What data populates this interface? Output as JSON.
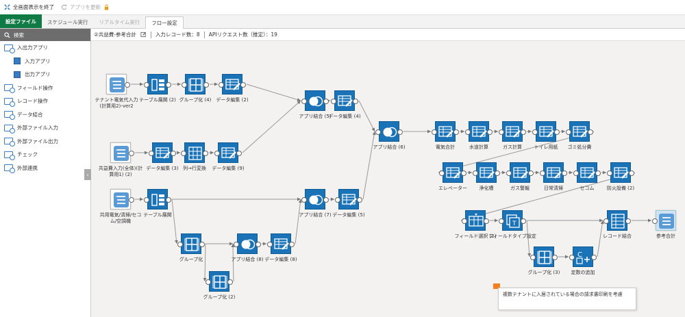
{
  "topbar": {
    "exit_fullscreen": "全画面表示を終了",
    "update_app": "アプリを更新"
  },
  "tabs": [
    {
      "label": "設定ファイル",
      "style": "green"
    },
    {
      "label": "スケジュール実行",
      "style": "normal"
    },
    {
      "label": "リアルタイム実行",
      "style": "dis"
    },
    {
      "label": "フロー設定",
      "style": "active"
    }
  ],
  "sidebar": {
    "search": "検索",
    "items": [
      {
        "label": "入出力アプリ",
        "type": "folder"
      },
      {
        "label": "入力アプリ",
        "type": "app"
      },
      {
        "label": "出力アプリ",
        "type": "app"
      },
      {
        "label": "フィールド操作",
        "type": "folder"
      },
      {
        "label": "レコード操作",
        "type": "folder"
      },
      {
        "label": "データ結合",
        "type": "folder"
      },
      {
        "label": "外部ファイル入力",
        "type": "folder"
      },
      {
        "label": "外部ファイル出力",
        "type": "folder"
      },
      {
        "label": "チェック",
        "type": "folder"
      },
      {
        "label": "外部連携",
        "type": "folder"
      }
    ],
    "collapse": "‹"
  },
  "info": {
    "flow_name": "②共益費-参考合計",
    "input_records": "入力レコード数：8",
    "api_requests": "APIリクエスト数（推定）：19"
  },
  "nodes": [
    {
      "id": "n1",
      "label": "テナント電気代入力(計算用2)-ver2",
      "icon": "input"
    },
    {
      "id": "n2",
      "label": "テーブル展開 (2)",
      "icon": "table-expand"
    },
    {
      "id": "n3",
      "label": "グループ化 (4)",
      "icon": "group"
    },
    {
      "id": "n4",
      "label": "データ編集 (2)",
      "icon": "edit"
    },
    {
      "id": "n5",
      "label": "アプリ結合 (5)",
      "icon": "join"
    },
    {
      "id": "n6",
      "label": "データ編集 (4)",
      "icon": "edit"
    },
    {
      "id": "n7",
      "label": "共益費入力(全体)(計算用1) (2)",
      "icon": "input"
    },
    {
      "id": "n8",
      "label": "データ編集 (3)",
      "icon": "edit"
    },
    {
      "id": "n9",
      "label": "列→行変換",
      "icon": "pivot"
    },
    {
      "id": "n10",
      "label": "データ編集 (9)",
      "icon": "edit"
    },
    {
      "id": "n11",
      "label": "アプリ結合 (6)",
      "icon": "join"
    },
    {
      "id": "n12",
      "label": "共用電気/清掃/セコム/空調機",
      "icon": "input"
    },
    {
      "id": "n13",
      "label": "テーブル展開",
      "icon": "table-expand"
    },
    {
      "id": "n14",
      "label": "アプリ結合 (7)",
      "icon": "join"
    },
    {
      "id": "n15",
      "label": "データ編集 (5)",
      "icon": "edit"
    },
    {
      "id": "n16",
      "label": "グループ化",
      "icon": "group"
    },
    {
      "id": "n17",
      "label": "アプリ結合 (8)",
      "icon": "join"
    },
    {
      "id": "n18",
      "label": "データ編集 (8)",
      "icon": "edit"
    },
    {
      "id": "n19",
      "label": "グループ化 (2)",
      "icon": "group"
    },
    {
      "id": "n20",
      "label": "電気合計",
      "icon": "edit"
    },
    {
      "id": "n21",
      "label": "水道計算",
      "icon": "edit"
    },
    {
      "id": "n22",
      "label": "ガス計算",
      "icon": "edit"
    },
    {
      "id": "n23",
      "label": "トイレ用紙",
      "icon": "edit"
    },
    {
      "id": "n24",
      "label": "ゴミ処分費",
      "icon": "edit"
    },
    {
      "id": "n25",
      "label": "エレベーター",
      "icon": "edit"
    },
    {
      "id": "n26",
      "label": "浄化槽",
      "icon": "edit"
    },
    {
      "id": "n27",
      "label": "ガス警報",
      "icon": "edit"
    },
    {
      "id": "n28",
      "label": "日常清掃",
      "icon": "edit"
    },
    {
      "id": "n29",
      "label": "セコム",
      "icon": "edit"
    },
    {
      "id": "n30",
      "label": "防火設備 (2)",
      "icon": "edit"
    },
    {
      "id": "n31",
      "label": "フィールド選択 (2)",
      "icon": "field-select"
    },
    {
      "id": "n32",
      "label": "フィールドタイプ設定",
      "icon": "field-type"
    },
    {
      "id": "n33",
      "label": "レコード結合",
      "icon": "record-join"
    },
    {
      "id": "n34",
      "label": "参考合計",
      "icon": "output"
    },
    {
      "id": "n35",
      "label": "グループ化 (3)",
      "icon": "group"
    },
    {
      "id": "n36",
      "label": "定数の追加",
      "icon": "constant"
    }
  ],
  "note": "複数テナントに入居されている場合の請求書印刷を考慮"
}
